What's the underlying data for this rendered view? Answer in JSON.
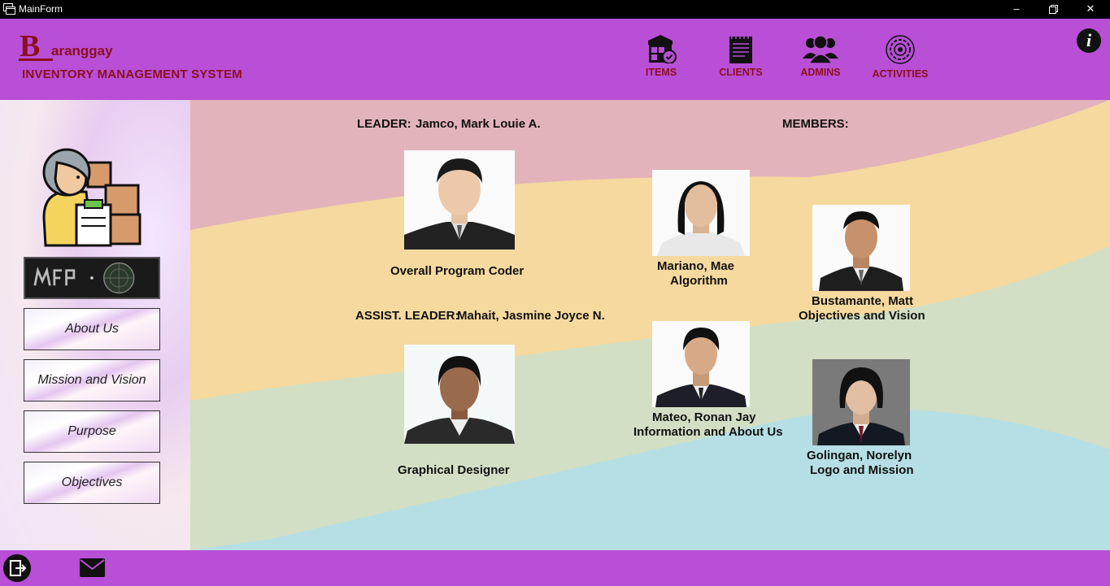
{
  "window": {
    "title": "MainForm"
  },
  "header": {
    "logo_letter": "B",
    "logo_word": "aranggay",
    "subtitle": "INVENTORY MANAGEMENT SYSTEM",
    "nav": [
      {
        "label": "ITEMS",
        "icon": "items-icon"
      },
      {
        "label": "CLIENTS",
        "icon": "clients-icon"
      },
      {
        "label": "ADMINS",
        "icon": "admins-icon"
      },
      {
        "label": "ACTIVITIES",
        "icon": "activities-icon"
      }
    ],
    "info_glyph": "i"
  },
  "sidebar": {
    "buttons": [
      "About Us",
      "Mission and Vision",
      "Purpose",
      "Objectives"
    ]
  },
  "main": {
    "leader_label": "LEADER:",
    "leader_name": "Jamco, Mark Louie A.",
    "leader_role": "Overall Program Coder",
    "assist_label": "ASSIST. LEADER:",
    "assist_name": "Mahait, Jasmine Joyce N.",
    "assist_role": "Graphical Designer",
    "members_label": "MEMBERS:",
    "members": [
      {
        "name": "Mariano, Mae",
        "role": "Algorithm"
      },
      {
        "name": "Bustamante, Matt",
        "role": "Objectives and Vision"
      },
      {
        "name": "Mateo, Ronan Jay",
        "role": "Information and About Us"
      },
      {
        "name": "Golingan, Norelyn",
        "role": "Logo and Mission"
      }
    ]
  },
  "colors": {
    "header_bg": "#b84fd6",
    "brand_text": "#8c0f1f",
    "wave_pink": "#e3b3bb",
    "wave_yellow": "#f5d99e",
    "wave_green": "#d2dfc5",
    "wave_blue": "#b5dfe4"
  }
}
